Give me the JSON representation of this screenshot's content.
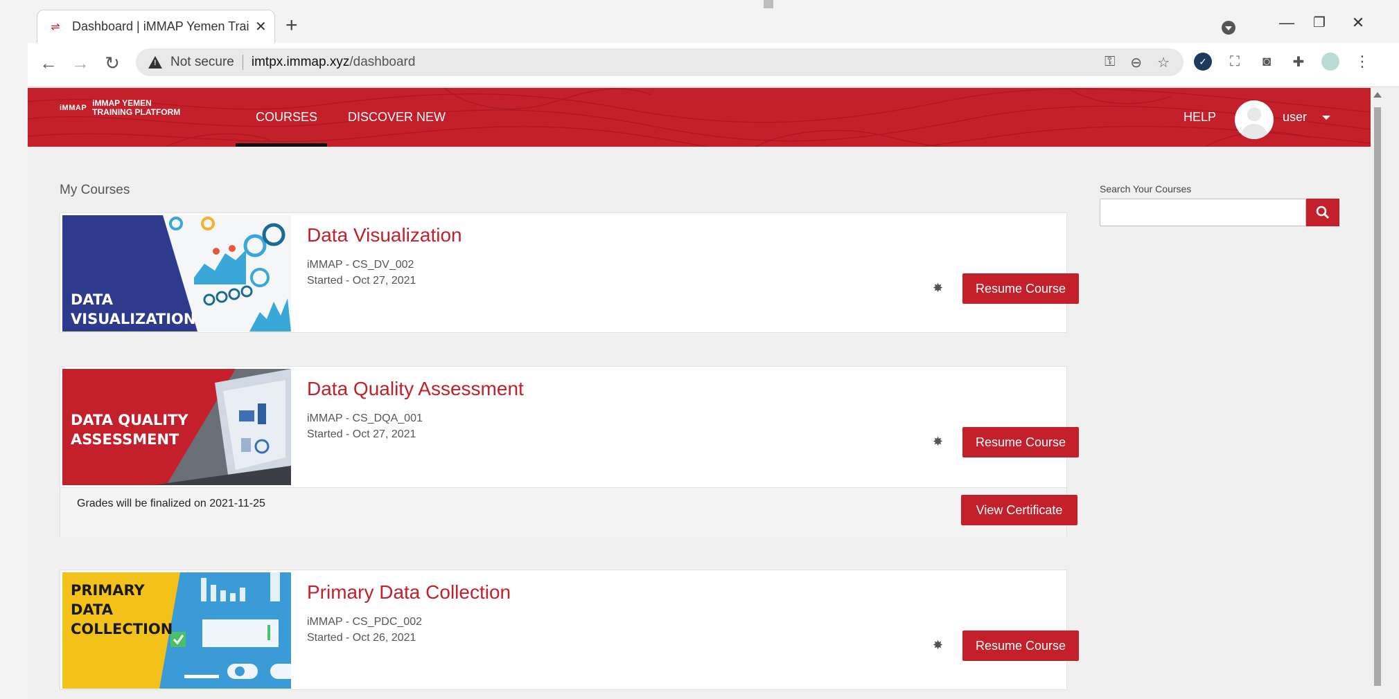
{
  "browser": {
    "tab_title": "Dashboard | iMMAP Yemen Training Platform",
    "security_label": "Not secure",
    "url_host": "imtpx.immap.xyz",
    "url_path": "/dashboard"
  },
  "header": {
    "logo_mark": "iMMAP",
    "logo_line1": "iMMAP YEMEN",
    "logo_line2": "TRAINING PLATFORM",
    "nav": [
      {
        "label": "COURSES",
        "active": true
      },
      {
        "label": "DISCOVER NEW",
        "active": false
      }
    ],
    "help_label": "HELP",
    "user_name": "user"
  },
  "main": {
    "section_title": "My Courses",
    "courses": [
      {
        "title": "Data Visualization",
        "org_code": "iMMAP - CS_DV_002",
        "started": "Started - Oct 27, 2021",
        "thumb_label": [
          "DATA",
          "VISUALIZATION"
        ],
        "action_label": "Resume Course"
      },
      {
        "title": "Data Quality Assessment",
        "org_code": "iMMAP - CS_DQA_001",
        "started": "Started - Oct 27, 2021",
        "thumb_label": [
          "DATA QUALITY",
          "ASSESSMENT"
        ],
        "action_label": "Resume Course",
        "footer_note": "Grades will be finalized on 2021-11-25",
        "footer_action": "View Certificate"
      },
      {
        "title": "Primary Data Collection",
        "org_code": "iMMAP - CS_PDC_002",
        "started": "Started - Oct 26, 2021",
        "thumb_label": [
          "PRIMARY",
          "DATA",
          "COLLECTION"
        ],
        "action_label": "Resume Course"
      }
    ]
  },
  "sidebar": {
    "search_label": "Search Your Courses",
    "search_value": ""
  },
  "colors": {
    "brand_red": "#c4202b",
    "navy": "#2e3a8c",
    "yellow": "#f2c21b"
  }
}
